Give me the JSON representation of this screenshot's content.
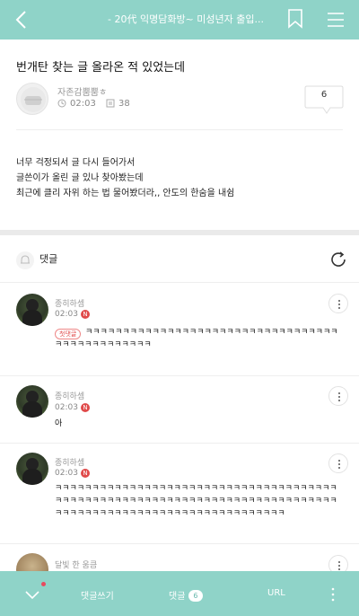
{
  "header": {
    "title": "- 20代 익명담화방~ 미성년자 출입..."
  },
  "post": {
    "title": "번개탄 찾는 글 올라온 적 있었는데",
    "author": "자존감뿜뿜ㅎ",
    "time": "02:03",
    "views": "38",
    "reply_count": "6",
    "body_lines": [
      "너무 걱정되서 글 다시 들어가서",
      "글쓴이가 올린 글 있나 찾아봤는데",
      "최근에 클리 자위 하는 법 물어봤더라,, 안도의 한숨을 내쉼"
    ]
  },
  "comments_section": {
    "label": "댓글"
  },
  "comments": [
    {
      "name": "종히하셈",
      "time": "02:03",
      "new_badge": "N",
      "first_badge": "첫댓글",
      "text": "ㅋㅋㅋㅋㅋㅋㅋㅋㅋㅋㅋㅋㅋㅋㅋㅋㅋㅋㅋㅋㅋㅋㅋㅋㅋㅋㅋㅋㅋㅋㅋㅋㅋㅋㅋㅋㅋㅋㅋㅋㅋㅋㅋㅋㅋㅋㅋ"
    },
    {
      "name": "종히하셈",
      "time": "02:03",
      "new_badge": "N",
      "text": "아"
    },
    {
      "name": "종히하셈",
      "time": "02:03",
      "new_badge": "N",
      "text": "ㅋㅋㅋㅋㅋㅋㅋㅋㅋㅋㅋㅋㅋㅋㅋㅋㅋㅋㅋㅋㅋㅋㅋㅋㅋㅋㅋㅋㅋㅋㅋㅋㅋㅋㅋㅋㅋㅋㅋㅋㅋㅋㅋㅋㅋㅋㅋㅋㅋㅋㅋㅋㅋㅋㅋㅋㅋㅋㅋㅋㅋㅋㅋㅋㅋㅋㅋㅋㅋㅋㅋㅋㅋㅋㅋㅋㅋㅋㅋㅋㅋㅋㅋㅋㅋㅋㅋㅋㅋㅋㅋㅋㅋㅋㅋㅋㅋㅋㅋㅋㅋㅋㅋㅋㅋㅋㅋ"
    },
    {
      "name": "달빛 한 움큼"
    }
  ],
  "bottom_bar": {
    "write_comment": "댓글쓰기",
    "comments_label": "댓글",
    "comments_count": "6",
    "url_label": "URL"
  },
  "colors": {
    "bar": "#8fd3c8",
    "badge_red": "#e04a4a"
  }
}
